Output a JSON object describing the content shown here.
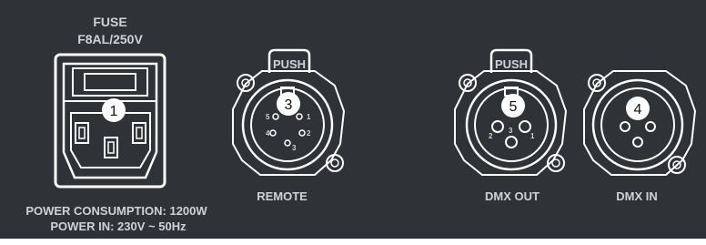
{
  "colors": {
    "panel": "#2f3236",
    "stroke": "#ffffff",
    "label": "#cfd2d6",
    "badge_fill": "#ffffff",
    "badge_text": "#111111"
  },
  "fuse": {
    "line1": "FUSE",
    "line2": "F8AL/250V"
  },
  "power": {
    "consumption": "POWER CONSUMPTION: 1200W",
    "input": "POWER IN: 230V ~ 50Hz",
    "badge": "1"
  },
  "remote": {
    "push": "PUSH",
    "badge": "3",
    "label": "REMOTE",
    "pins": [
      "1",
      "2",
      "3",
      "4",
      "5"
    ]
  },
  "dmx_out": {
    "push": "PUSH",
    "badge": "5",
    "label": "DMX OUT",
    "pins": [
      "1",
      "2",
      "3"
    ]
  },
  "dmx_in": {
    "badge": "4",
    "label": "DMX IN"
  }
}
